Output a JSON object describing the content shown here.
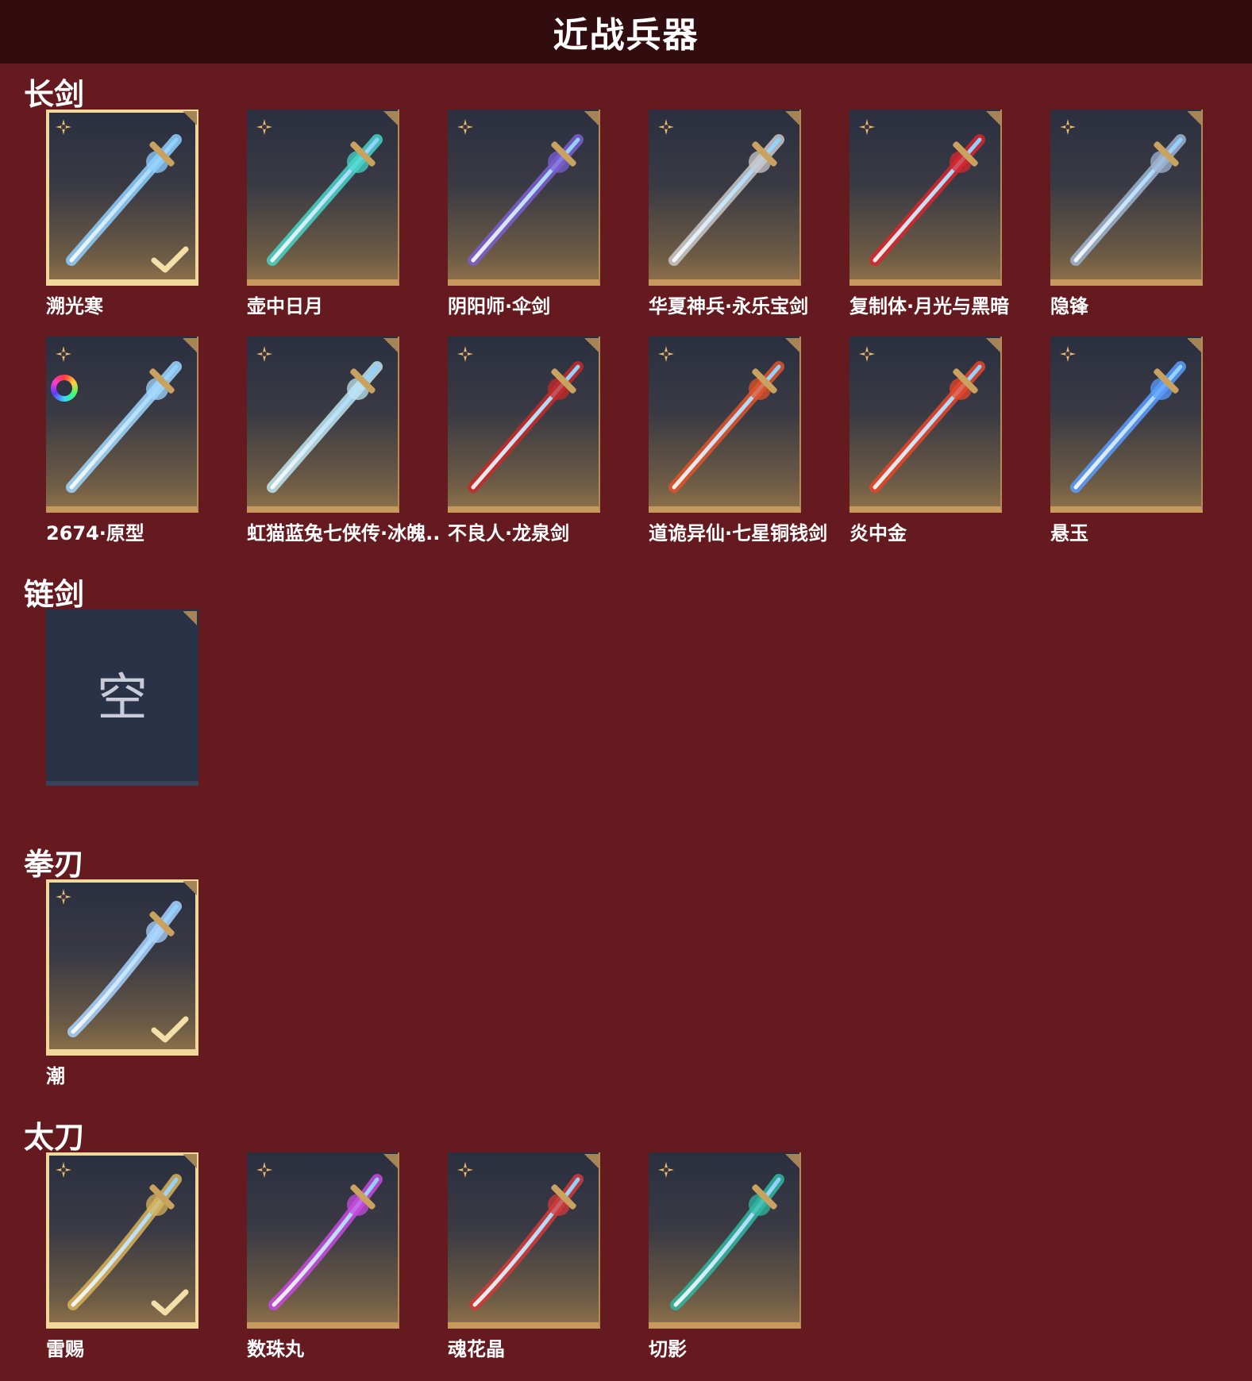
{
  "title": "近战兵器",
  "sections": [
    {
      "heading": "长剑",
      "items": [
        {
          "label": "溯光寒",
          "selected": true,
          "icon": "ice-sword-icon",
          "color": "#8fd0ff"
        },
        {
          "label": "壶中日月",
          "icon": "jade-sword-icon",
          "color": "#46d6c8"
        },
        {
          "label": "阴阳师·伞剑",
          "icon": "umbrella-sword-icon",
          "color": "#7a5fd0"
        },
        {
          "label": "华夏神兵·永乐宝剑",
          "icon": "steel-sword-icon",
          "color": "#c9c9c9"
        },
        {
          "label": "复制体·月光与黑暗",
          "icon": "crimson-sword-icon",
          "color": "#d8262d"
        },
        {
          "label": "隐锋",
          "icon": "thin-sword-icon",
          "color": "#9fb4d0"
        },
        {
          "label": "2674·原型",
          "icon": "light-sword-icon",
          "color": "#9fd8ff",
          "dye": true
        },
        {
          "label": "虹猫蓝兔七侠传·冰魄..",
          "icon": "frost-sword-icon",
          "color": "#bfe6f0"
        },
        {
          "label": "不良人·龙泉剑",
          "icon": "dark-sword-icon",
          "color": "#c42a2a"
        },
        {
          "label": "道诡异仙·七星铜钱剑",
          "icon": "coin-sword-icon",
          "color": "#e0532a"
        },
        {
          "label": "炎中金",
          "icon": "flame-sword-icon",
          "color": "#e8452a"
        },
        {
          "label": "悬玉",
          "icon": "azure-sword-icon",
          "color": "#5a9cff"
        }
      ]
    },
    {
      "heading": "链剑",
      "items": [
        {
          "label": "",
          "empty": true,
          "empty_text": "空",
          "icon": "empty-slot-icon"
        }
      ]
    },
    {
      "heading": "拳刃",
      "items": [
        {
          "label": "潮",
          "selected": true,
          "icon": "claw-blade-icon",
          "color": "#a8d4ff"
        }
      ]
    },
    {
      "heading": "太刀",
      "items": [
        {
          "label": "雷赐",
          "selected": true,
          "icon": "thunder-katana-icon",
          "color": "#d9b45a"
        },
        {
          "label": "数珠丸",
          "icon": "bead-katana-icon",
          "color": "#c84ae0"
        },
        {
          "label": "魂花晶",
          "icon": "crystal-katana-icon",
          "color": "#d23a3a"
        },
        {
          "label": "切影",
          "icon": "shadow-katana-icon",
          "color": "#2fb8a0"
        }
      ]
    }
  ]
}
